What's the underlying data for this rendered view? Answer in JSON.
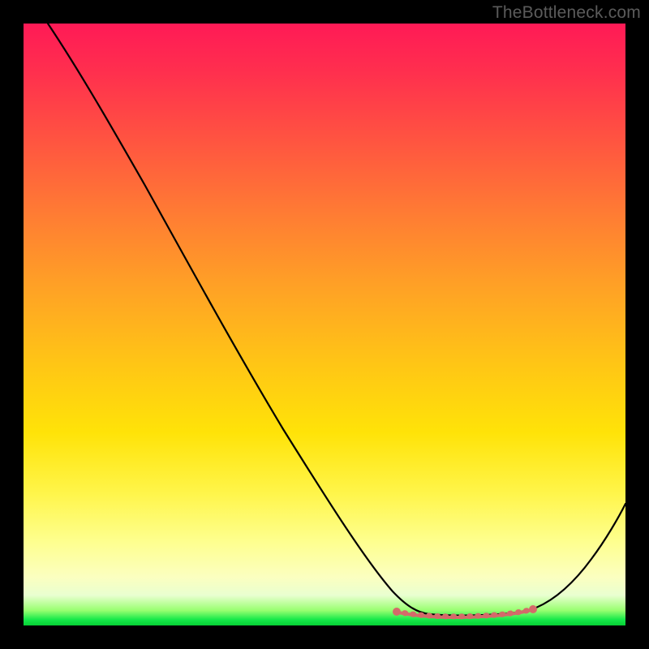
{
  "watermark": "TheBottleneck.com",
  "chart_data": {
    "type": "line",
    "title": "",
    "xlabel": "",
    "ylabel": "",
    "xlim": [
      0,
      100
    ],
    "ylim": [
      0,
      100
    ],
    "grid": false,
    "legend": false,
    "series": [
      {
        "name": "bottleneck-curve",
        "color": "#000000",
        "x": [
          4,
          10,
          18,
          26,
          34,
          42,
          50,
          58,
          62,
          66,
          70,
          74,
          78,
          82,
          86,
          90,
          94,
          98,
          100
        ],
        "y": [
          100,
          92,
          80,
          68,
          56,
          44,
          32,
          20,
          12,
          6,
          3,
          2,
          2,
          2,
          4,
          8,
          14,
          22,
          28
        ]
      },
      {
        "name": "highlight-band",
        "color": "#d46a6a",
        "x": [
          62,
          84
        ],
        "y": [
          3,
          3
        ]
      }
    ],
    "annotations": []
  },
  "colors": {
    "frame": "#000000",
    "curve": "#000000",
    "highlight": "#d46a6a",
    "watermark": "#5b5b5b"
  }
}
